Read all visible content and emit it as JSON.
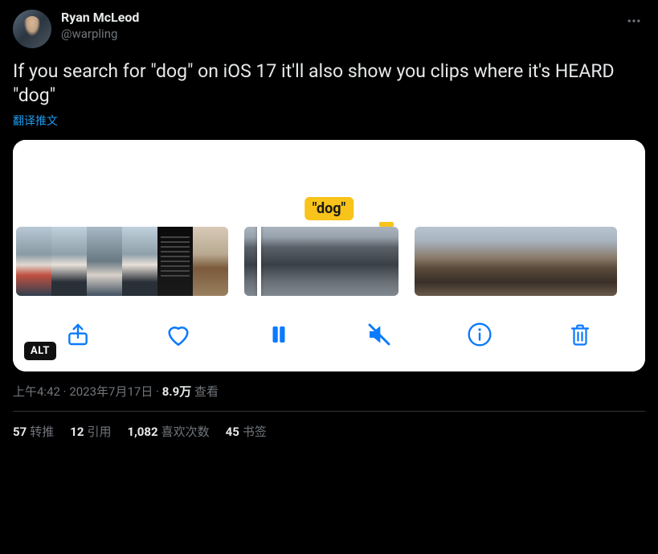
{
  "author": {
    "display_name": "Ryan McLeod",
    "handle": "@warpling"
  },
  "body": "If you search for \"dog\" on iOS 17 it'll also show you clips where it's HEARD \"dog\"",
  "translate_label": "翻译推文",
  "media": {
    "badge_text": "\"dog\"",
    "alt_label": "ALT"
  },
  "meta": {
    "time": "上午4:42",
    "date": "2023年7月17日",
    "views_count": "8.9万",
    "views_label": "查看"
  },
  "stats": {
    "retweets": {
      "count": "57",
      "label": "转推"
    },
    "quotes": {
      "count": "12",
      "label": "引用"
    },
    "likes": {
      "count": "1,082",
      "label": "喜欢次数"
    },
    "bookmarks": {
      "count": "45",
      "label": "书签"
    }
  }
}
